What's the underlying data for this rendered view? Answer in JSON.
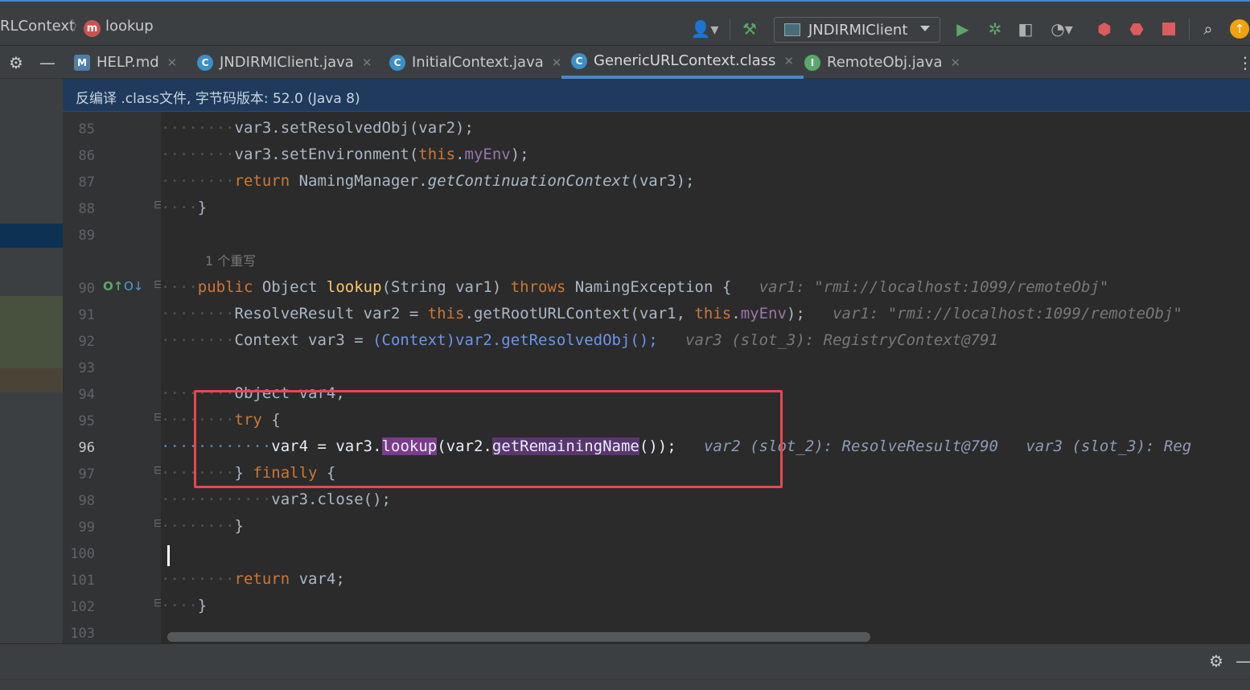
{
  "breadcrumb": {
    "class_name": "RLContext",
    "method_badge": "m",
    "method_name": "lookup"
  },
  "toolbar": {
    "run_config": "JNDIRMIClient"
  },
  "tabs": [
    {
      "label": "HELP.md",
      "icon": "markdown-icon",
      "active": false
    },
    {
      "label": "JNDIRMIClient.java",
      "icon": "class-icon",
      "active": false
    },
    {
      "label": "InitialContext.java",
      "icon": "class-icon",
      "active": false
    },
    {
      "label": "GenericURLContext.class",
      "icon": "class-icon",
      "active": true
    },
    {
      "label": "RemoteObj.java",
      "icon": "interface-icon",
      "active": false
    }
  ],
  "banner": {
    "text": "反编译 .class文件, 字节码版本: 52.0 (Java 8)"
  },
  "editor": {
    "line_numbers": [
      "85",
      "86",
      "87",
      "88",
      "89",
      "",
      "90",
      "91",
      "92",
      "93",
      "94",
      "95",
      "96",
      "97",
      "98",
      "99",
      "100",
      "101",
      "102",
      "103"
    ],
    "overrides_hint": "1 个重写",
    "hints": {
      "line90": "var1: \"rmi://localhost:1099/remoteObj\"",
      "line91": "var1: \"rmi://localhost:1099/remoteObj\"",
      "line92": "var3 (slot_3): RegistryContext@791",
      "line96a": "var2 (slot_2): ResolveResult@790",
      "line96b": "var3 (slot_3): Reg"
    },
    "current_line": "96"
  },
  "colors": {
    "accent": "#4a88c7",
    "highlight": "#2d5aa0",
    "annotation": "#e5484d"
  }
}
